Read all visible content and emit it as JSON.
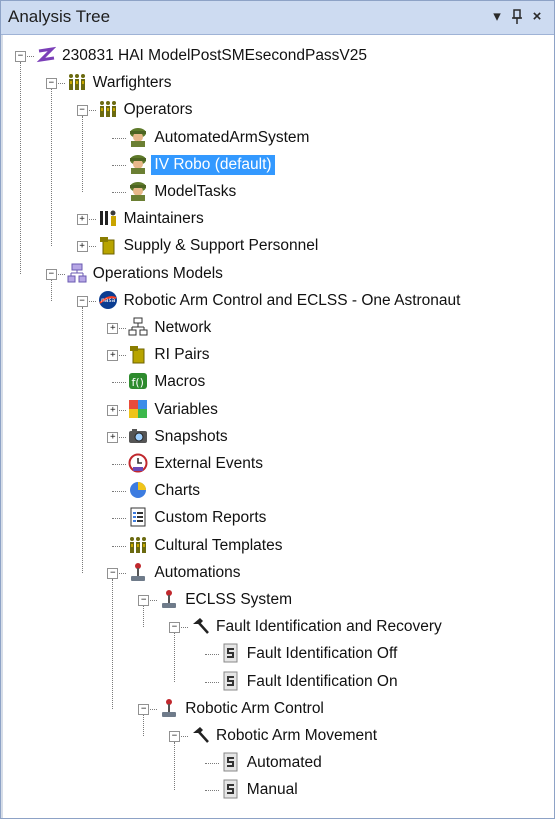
{
  "panel": {
    "title": "Analysis Tree",
    "buttons": {
      "dropdown": "▾",
      "pin": "ᵖ",
      "close": "×"
    }
  },
  "colors": {
    "titlebar_bg": "#cddbf1",
    "selection_bg": "#3399ff",
    "selection_fg": "#ffffff"
  },
  "tree": {
    "nodes": [
      {
        "label": "230831 HAI ModelPostSMEsecondPassV25",
        "icon": "model-z-icon",
        "expander": "−",
        "selected": false
      },
      {
        "label": "Warfighters",
        "icon": "people-group-icon",
        "expander": "−",
        "selected": false
      },
      {
        "label": "Operators",
        "icon": "people-group-icon",
        "expander": "−",
        "selected": false
      },
      {
        "label": "AutomatedArmSystem",
        "icon": "soldier-icon",
        "expander": "",
        "selected": false
      },
      {
        "label": "IV Robo (default)",
        "icon": "soldier-icon",
        "expander": "",
        "selected": true
      },
      {
        "label": "ModelTasks",
        "icon": "soldier-icon",
        "expander": "",
        "selected": false
      },
      {
        "label": "Maintainers",
        "icon": "tools-person-icon",
        "expander": "+",
        "selected": false
      },
      {
        "label": "Supply & Support Personnel",
        "icon": "supply-box-icon",
        "expander": "+",
        "selected": false
      },
      {
        "label": "Operations Models",
        "icon": "network-blocks-icon",
        "expander": "−",
        "selected": false
      },
      {
        "label": "Robotic Arm Control and ECLSS - One Astronaut",
        "icon": "nasa-logo-icon",
        "expander": "−",
        "selected": false
      },
      {
        "label": "Network",
        "icon": "network-tree-icon",
        "expander": "+",
        "selected": false
      },
      {
        "label": "RI Pairs",
        "icon": "supply-box-icon",
        "expander": "+",
        "selected": false
      },
      {
        "label": "Macros",
        "icon": "macro-function-icon",
        "expander": "",
        "selected": false
      },
      {
        "label": "Variables",
        "icon": "variables-grid-icon",
        "expander": "+",
        "selected": false
      },
      {
        "label": "Snapshots",
        "icon": "camera-icon",
        "expander": "+",
        "selected": false
      },
      {
        "label": "External Events",
        "icon": "clock-calendar-icon",
        "expander": "",
        "selected": false
      },
      {
        "label": "Charts",
        "icon": "pie-chart-icon",
        "expander": "",
        "selected": false
      },
      {
        "label": "Custom Reports",
        "icon": "report-icon",
        "expander": "",
        "selected": false
      },
      {
        "label": "Cultural Templates",
        "icon": "people-group-icon",
        "expander": "",
        "selected": false
      },
      {
        "label": "Automations",
        "icon": "joystick-icon",
        "expander": "−",
        "selected": false
      },
      {
        "label": "ECLSS System",
        "icon": "joystick-icon",
        "expander": "−",
        "selected": false
      },
      {
        "label": "Fault Identification and Recovery",
        "icon": "hammer-icon",
        "expander": "−",
        "selected": false
      },
      {
        "label": "Fault Identification Off",
        "icon": "switch-icon",
        "expander": "",
        "selected": false
      },
      {
        "label": "Fault Identification On",
        "icon": "switch-icon",
        "expander": "",
        "selected": false
      },
      {
        "label": "Robotic Arm Control",
        "icon": "joystick-icon",
        "expander": "−",
        "selected": false
      },
      {
        "label": "Robotic Arm Movement",
        "icon": "hammer-icon",
        "expander": "−",
        "selected": false
      },
      {
        "label": "Automated",
        "icon": "switch-icon",
        "expander": "",
        "selected": false
      },
      {
        "label": "Manual",
        "icon": "switch-icon",
        "expander": "",
        "selected": false
      }
    ]
  }
}
